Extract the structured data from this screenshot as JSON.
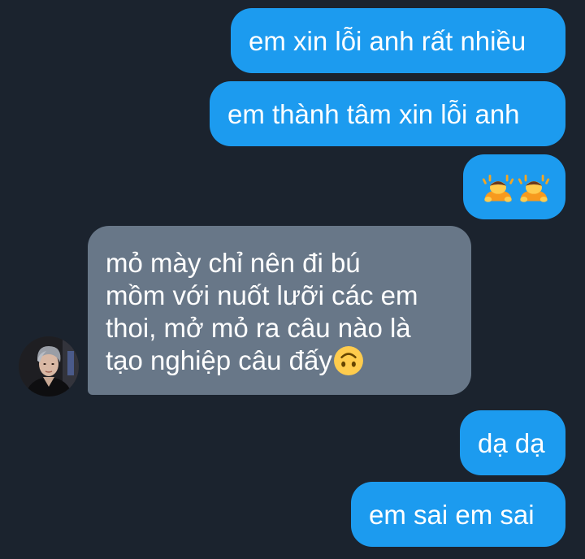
{
  "messages": {
    "m1": {
      "text": "em xin lỗi anh rất nhiều"
    },
    "m2": {
      "text": "em thành tâm xin lỗi anh"
    },
    "m3": {
      "emoji": [
        "person-bowing",
        "person-bowing"
      ]
    },
    "m4": {
      "lines": [
        "mỏ mày chỉ nên đi bú",
        "mồm với nuốt lưỡi các em",
        "thoi, mở mỏ ra câu nào là",
        "tạo nghiệp câu đấy"
      ],
      "trailing_emoji": "upside-down-face"
    },
    "m5": {
      "text": "dạ dạ"
    },
    "m6": {
      "text": "em sai em sai"
    }
  },
  "colors": {
    "background": "#1b232e",
    "outgoing_bubble": "#1c9bef",
    "incoming_bubble": "#687788",
    "text": "#ffffff"
  }
}
